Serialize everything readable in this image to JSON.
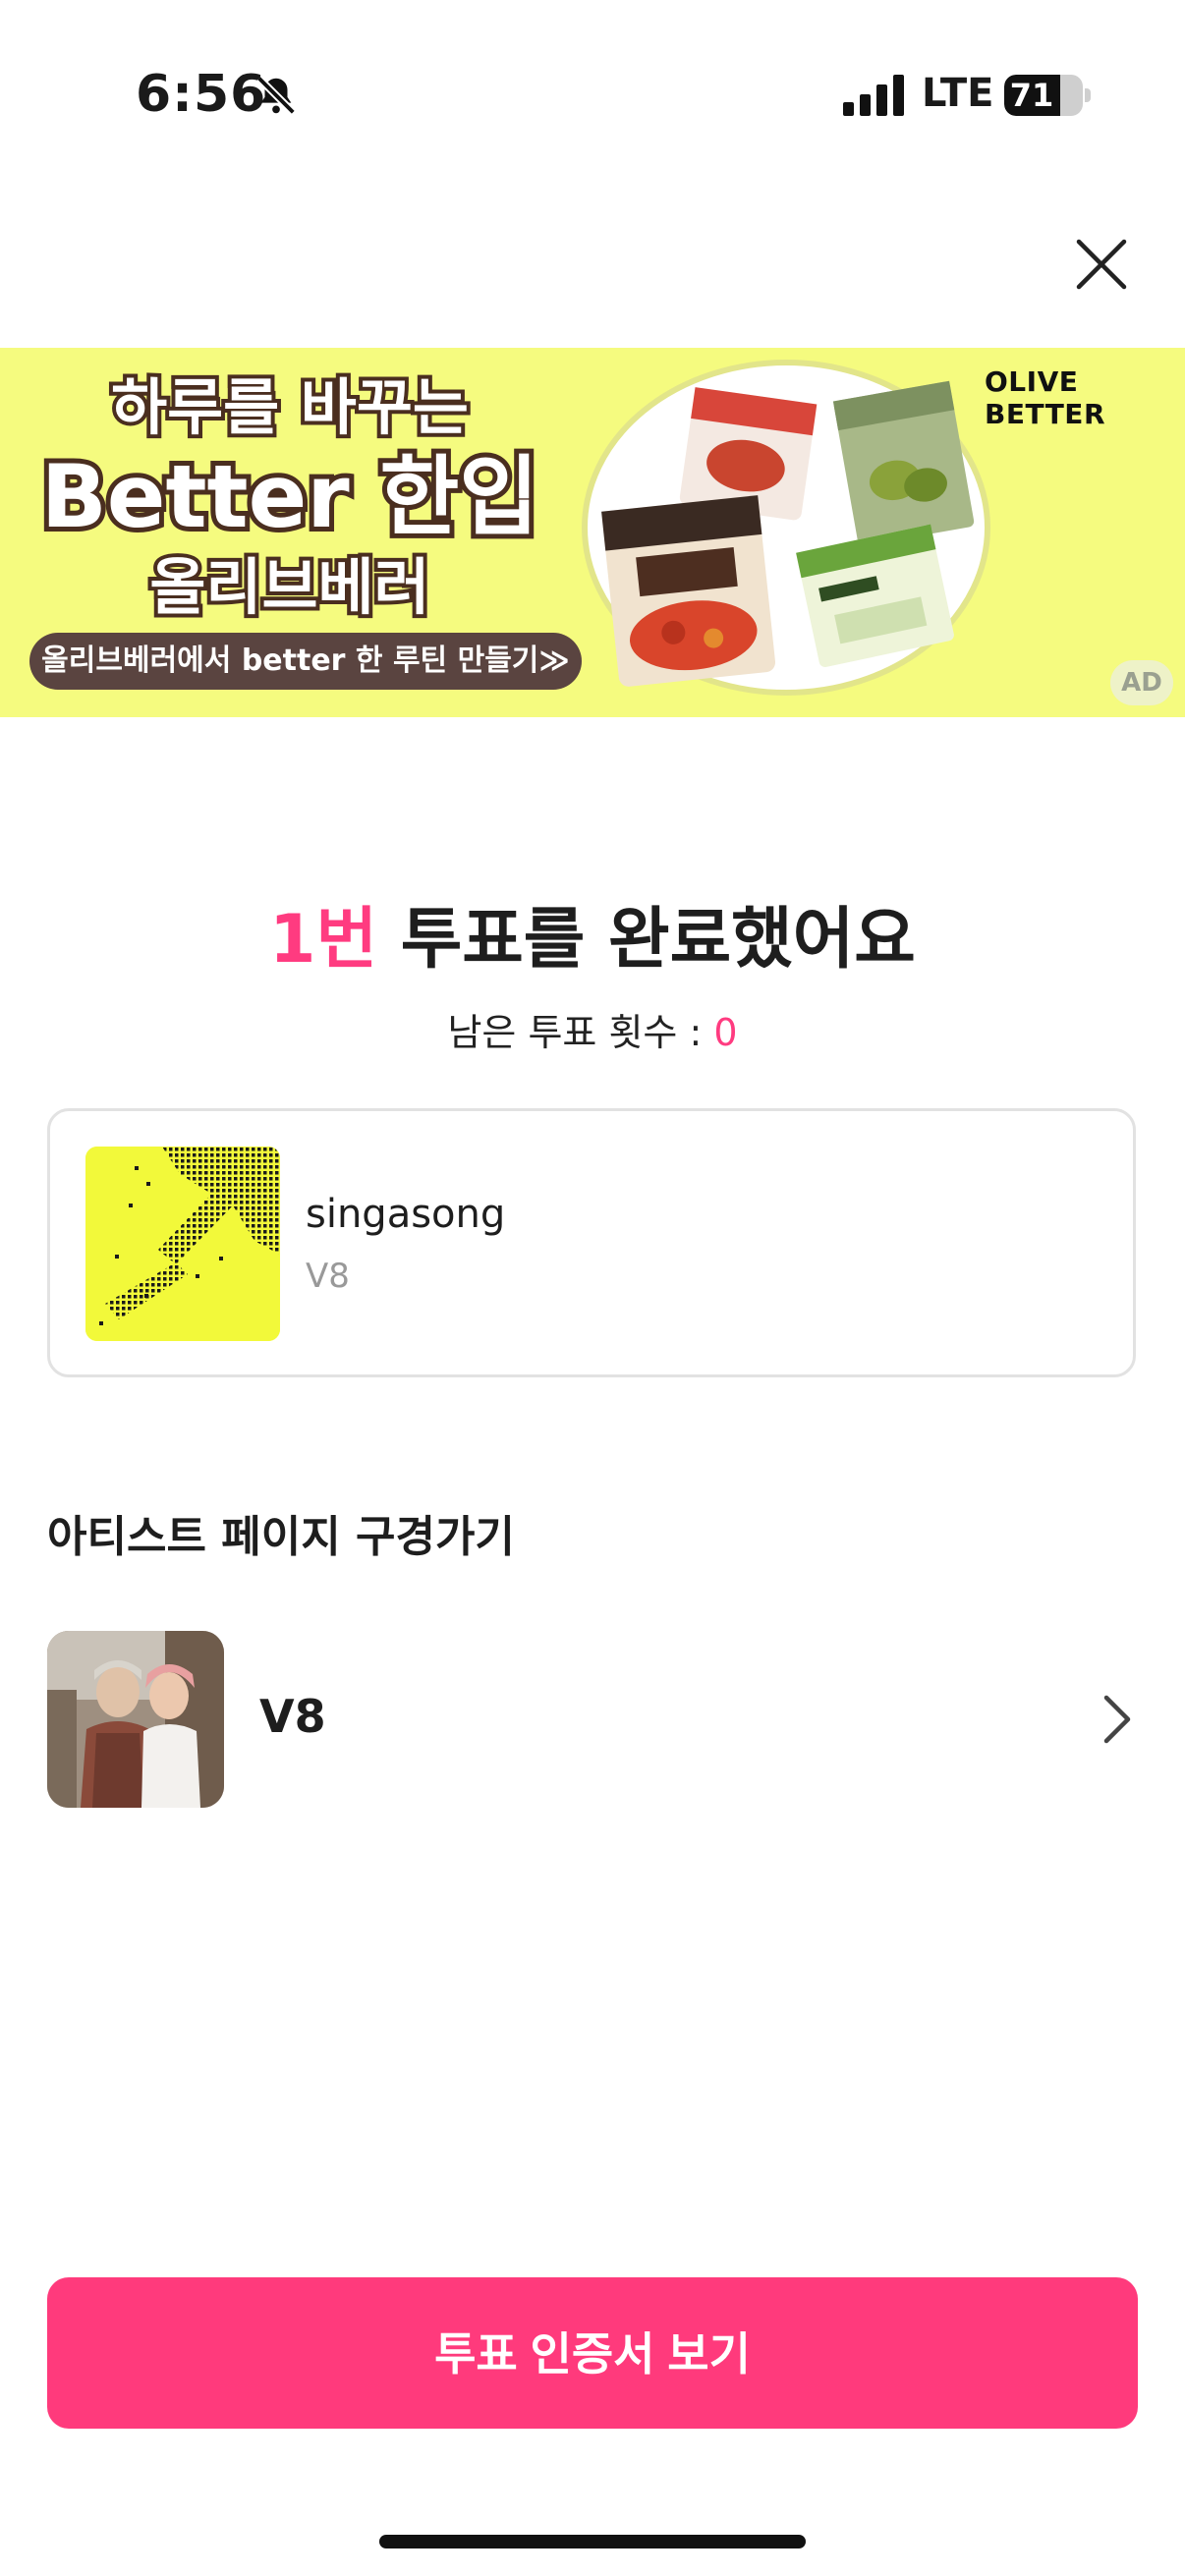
{
  "status_bar": {
    "time": "6:56",
    "network": "LTE",
    "battery": "71",
    "battery_level": 0.71
  },
  "ad": {
    "headline_line1": "하루를 바꾸는",
    "headline_line2": "Better 한입",
    "headline_line3": "올리브베러",
    "cta": "올리브베러에서 better 한 루틴 만들기≫",
    "brand": "OLIVE BETTER",
    "badge": "AD",
    "colors": {
      "background": "#f5fb7f",
      "outline": "#4a2e1f"
    }
  },
  "result": {
    "count": "1번",
    "title_rest": " 투표를 완료했어요",
    "remaining_label": "남은 투표 횟수 : ",
    "remaining_value": "0",
    "accent_color": "#ff3b80"
  },
  "song": {
    "title": "singasong",
    "artist": "V8"
  },
  "artist_section": {
    "title": "아티스트 페이지 구경가기",
    "artist_name": "V8"
  },
  "cta": {
    "label": "투표 인증서 보기",
    "color": "#ff3a7c"
  },
  "icons": [
    "bell-slash-icon",
    "signal-icon",
    "battery-icon",
    "close-icon",
    "chevron-right-icon"
  ]
}
